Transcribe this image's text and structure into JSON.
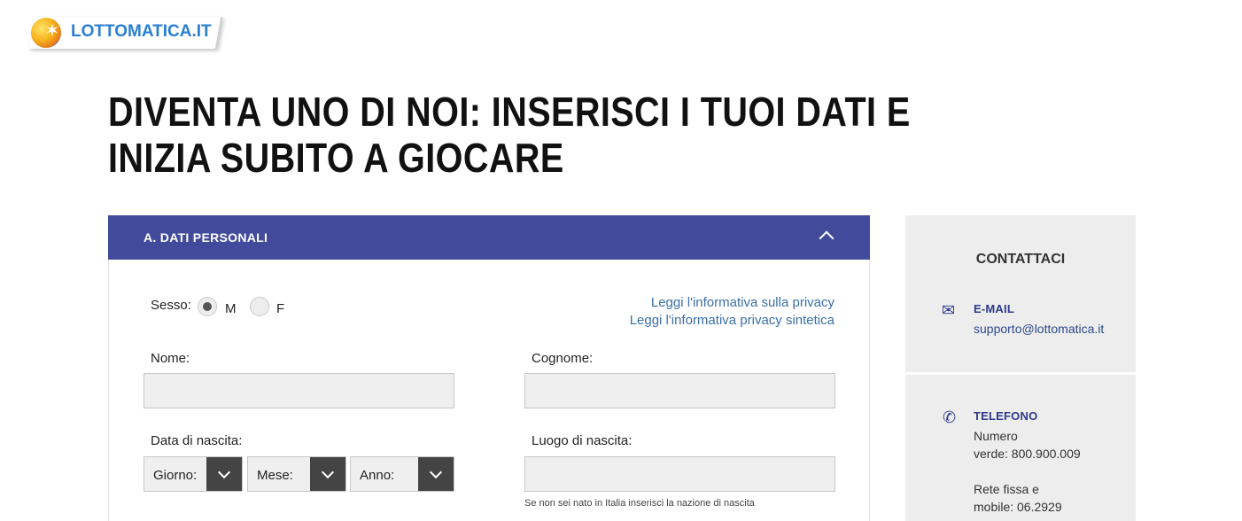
{
  "logo": {
    "text": "LOTTOMATICA.IT"
  },
  "headline": "DIVENTA UNO DI NOI: INSERISCI I TUOI DATI E INIZIA SUBITO A GIOCARE",
  "form": {
    "section_title": "A. DATI PERSONALI",
    "sex_label": "Sesso:",
    "sex_options": {
      "m": "M",
      "f": "F"
    },
    "privacy_link": "Leggi l'informativa sulla privacy",
    "privacy_short_link": "Leggi l'informativa privacy sintetica",
    "nome_label": "Nome:",
    "cognome_label": "Cognome:",
    "birthdate_label": "Data di nascita:",
    "birthplace_label": "Luogo di nascita:",
    "day_select": "Giorno:",
    "month_select": "Mese:",
    "year_select": "Anno:",
    "birthplace_hint": "Se non sei nato in Italia inserisci la nazione di nascita"
  },
  "contact": {
    "title": "CONTATTACI",
    "email_heading": "E-MAIL",
    "email_value": "supporto@lottomatica.it",
    "phone_heading": "TELEFONO",
    "phone_line1": "Numero",
    "phone_line2": "verde: 800.900.009",
    "phone_line3": "Rete fissa e",
    "phone_line4": "mobile: 06.2929"
  },
  "colors": {
    "header_bar": "#424a9c",
    "link": "#3a6fa8",
    "contact_accent": "#2e3a8c"
  }
}
